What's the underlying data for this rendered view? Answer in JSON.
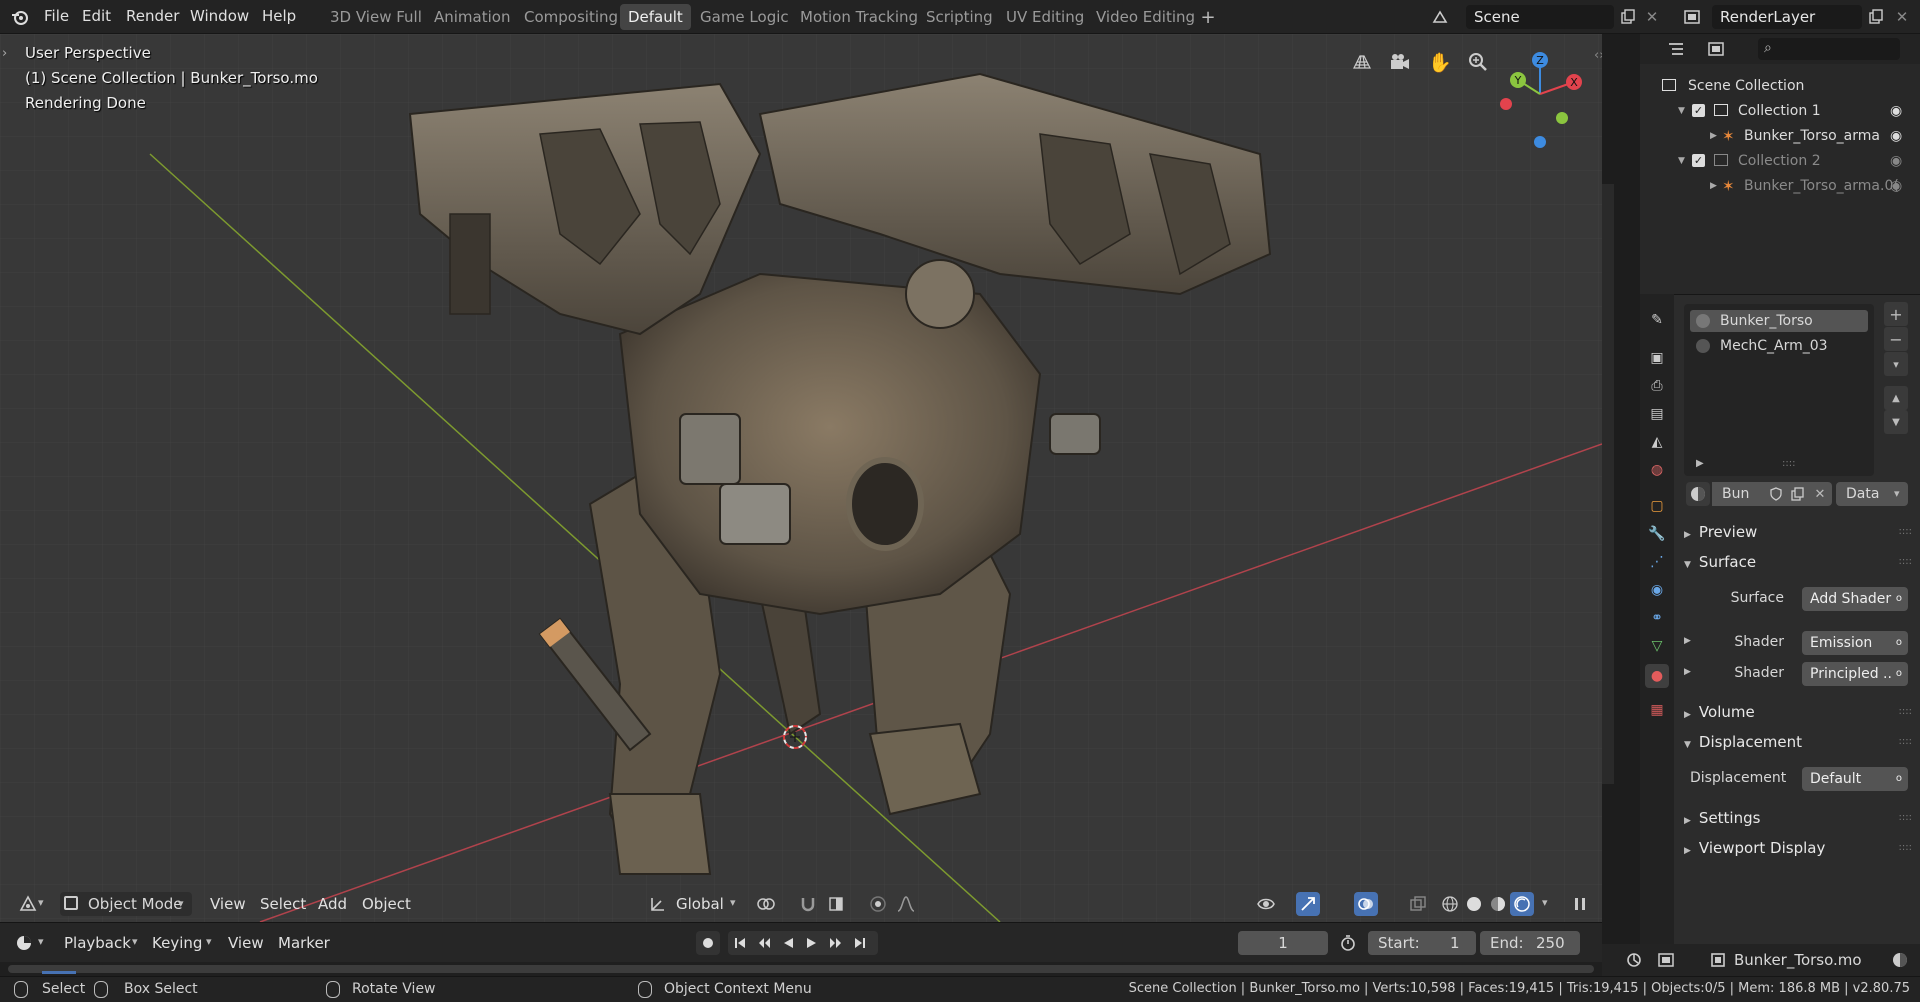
{
  "top_menu": [
    "File",
    "Edit",
    "Render",
    "Window",
    "Help"
  ],
  "workspaces": [
    "3D View Full",
    "Animation",
    "Compositing",
    "Default",
    "Game Logic",
    "Motion Tracking",
    "Scripting",
    "UV Editing",
    "Video Editing"
  ],
  "active_workspace": "Default",
  "scene_field": "Scene",
  "view_layer_field": "RenderLayer",
  "viewport": {
    "overlay_lines": [
      "User Perspective",
      "(1) Scene Collection | Bunker_Torso.mo",
      "Rendering Done"
    ],
    "header": {
      "mode": "Object Mode",
      "menus": [
        "View",
        "Select",
        "Add",
        "Object"
      ],
      "transform_orientation": "Global"
    },
    "gizmo_axes": {
      "x": "X",
      "y": "Y",
      "z": "Z"
    }
  },
  "timeline": {
    "menus": [
      "Playback",
      "Keying",
      "View",
      "Marker"
    ],
    "current_frame": "1",
    "start_label": "Start:",
    "start": "1",
    "end_label": "End:",
    "end": "250"
  },
  "outliner": {
    "rows": [
      {
        "label": "Scene Collection",
        "indent": 0,
        "kind": "scene"
      },
      {
        "label": "Collection 1",
        "indent": 1,
        "kind": "collection"
      },
      {
        "label": "Bunker_Torso_arma",
        "indent": 2,
        "kind": "armature"
      },
      {
        "label": "Collection 2",
        "indent": 1,
        "kind": "collection-dim"
      },
      {
        "label": "Bunker_Torso_arma.0(",
        "indent": 2,
        "kind": "armature-dim"
      }
    ]
  },
  "properties": {
    "material_slots": [
      "Bunker_Torso",
      "MechC_Arm_03"
    ],
    "material_name_field": "Bun",
    "link_dropdown": "Data",
    "panels": {
      "preview": "Preview",
      "surface": "Surface",
      "volume": "Volume",
      "displacement": "Displacement",
      "settings": "Settings",
      "viewport_display": "Viewport Display"
    },
    "surface_label": "Surface",
    "surface_value": "Add Shader",
    "shader1_label": "Shader",
    "shader1_value": "Emission",
    "shader2_label": "Shader",
    "shader2_value": "Principled ..",
    "displacement_label": "Displacement",
    "displacement_value": "Default"
  },
  "lower_right_field": "Bunker_Torso.mo",
  "statusbar": {
    "select": "Select",
    "box_select": "Box Select",
    "rotate_view": "Rotate View",
    "context_menu": "Object Context Menu",
    "stats": "Scene Collection | Bunker_Torso.mo | Verts:10,598 | Faces:19,415 | Tris:19,415 | Objects:0/5 | Mem: 186.8 MB | v2.80.75"
  },
  "colors": {
    "accent_blue": "#4772b3",
    "x_axis": "#e2434d",
    "y_axis": "#8bc53f",
    "z_axis": "#3d8be0"
  }
}
